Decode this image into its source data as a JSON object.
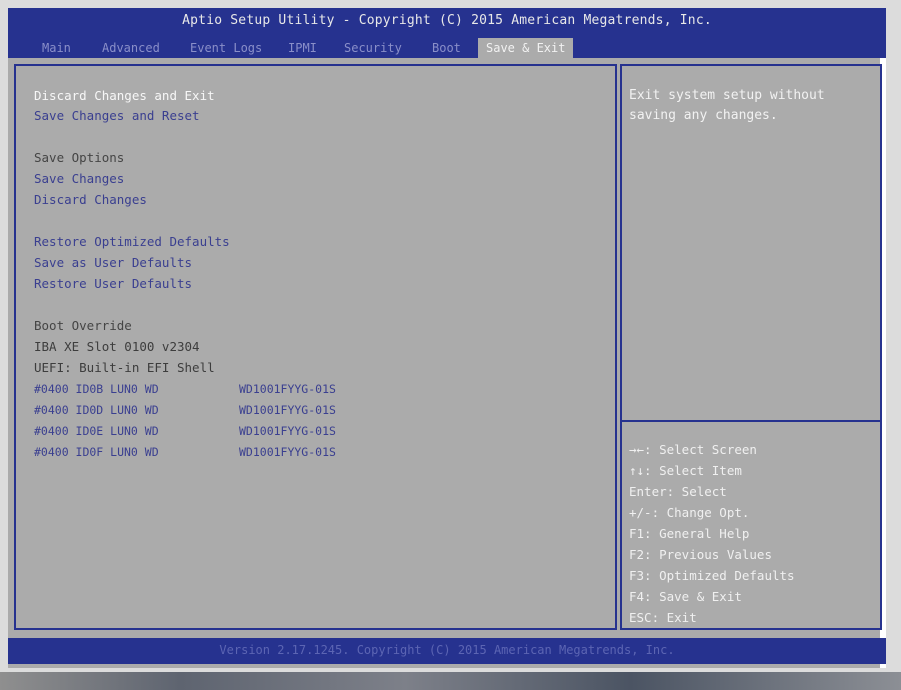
{
  "header": {
    "title": "Aptio Setup Utility - Copyright (C) 2015 American Megatrends, Inc.",
    "tabs": [
      {
        "label": "Main",
        "active": false
      },
      {
        "label": "Advanced",
        "active": false
      },
      {
        "label": "Event Logs",
        "active": false
      },
      {
        "label": "IPMI",
        "active": false
      },
      {
        "label": "Security",
        "active": false
      },
      {
        "label": "Boot",
        "active": false
      },
      {
        "label": "Save & Exit",
        "active": true
      }
    ]
  },
  "menu": {
    "discard_exit": "Discard Changes and Exit",
    "save_reset": "Save Changes and Reset",
    "save_options_heading": "Save Options",
    "save_changes": "Save Changes",
    "discard_changes": "Discard Changes",
    "restore_optimized": "Restore Optimized Defaults",
    "save_user_defaults": "Save as User Defaults",
    "restore_user_defaults": "Restore User Defaults",
    "boot_override_heading": "Boot Override",
    "boot_items": [
      {
        "label": "IBA XE Slot 0100 v2304",
        "model": ""
      },
      {
        "label": "UEFI: Built-in EFI Shell",
        "model": ""
      },
      {
        "label": "#0400 ID0B LUN0 WD",
        "model": "WD1001FYYG-01S"
      },
      {
        "label": "#0400 ID0D LUN0 WD",
        "model": "WD1001FYYG-01S"
      },
      {
        "label": "#0400 ID0E LUN0 WD",
        "model": "WD1001FYYG-01S"
      },
      {
        "label": "#0400 ID0F LUN0 WD",
        "model": "WD1001FYYG-01S"
      }
    ]
  },
  "help": {
    "description": "Exit system setup without\nsaving any changes.",
    "keys": [
      "→←: Select Screen",
      "↑↓: Select Item",
      "Enter: Select",
      "+/-: Change Opt.",
      "F1: General Help",
      "F2: Previous Values",
      "F3: Optimized Defaults",
      "F4: Save & Exit",
      "ESC: Exit"
    ]
  },
  "footer": {
    "version": "Version 2.17.1245. Copyright (C) 2015 American Megatrends, Inc."
  },
  "colors": {
    "bar_blue": "#26328f",
    "panel_gray": "#ababab",
    "item_blue": "#3a3f90",
    "highlight_white": "#f7f7f7"
  }
}
